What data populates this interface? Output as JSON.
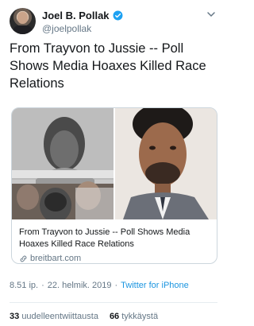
{
  "author": {
    "display_name": "Joel B. Pollak",
    "handle": "@joelpollak",
    "verified": true
  },
  "tweet": {
    "text": "From Trayvon to Jussie -- Poll Shows Media Hoaxes Killed Race Relations"
  },
  "card": {
    "title": "From Trayvon to Jussie -- Poll Shows Media Hoaxes Killed Race Relations",
    "domain": "breitbart.com"
  },
  "meta": {
    "time": "8.51 ip.",
    "separator": "·",
    "date": "22. helmik. 2019",
    "source": "Twitter for iPhone"
  },
  "stats": {
    "retweets_count": "33",
    "retweets_label": "uudelleentwiittausta",
    "likes_count": "66",
    "likes_label": "tykkäystä"
  },
  "colors": {
    "accent": "#1da1f2",
    "link": "#1b95e0",
    "secondary_text": "#657786"
  }
}
